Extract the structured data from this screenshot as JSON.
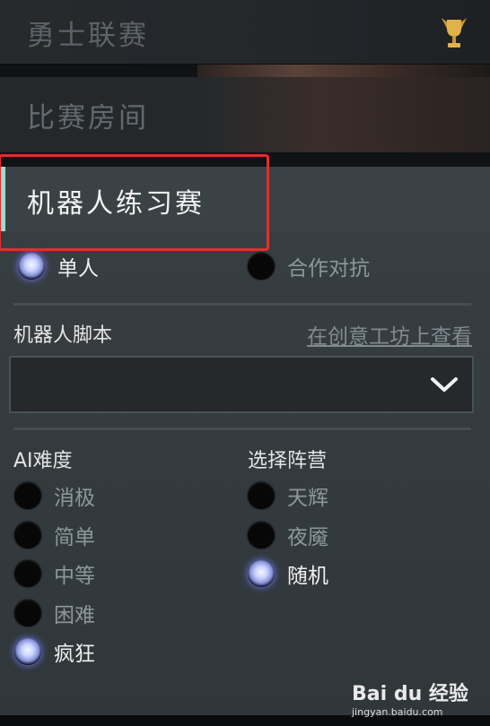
{
  "menu": {
    "top_label": "勇士联赛",
    "room_label": "比赛房间",
    "selected_label": "机器人练习赛"
  },
  "mode": {
    "options": [
      {
        "label": "单人",
        "selected": true
      },
      {
        "label": "合作对抗",
        "selected": false
      }
    ]
  },
  "script": {
    "title": "机器人脚本",
    "workshop_link": "在创意工坊上查看",
    "dropdown_value": ""
  },
  "ai_difficulty": {
    "title": "AI难度",
    "options": [
      {
        "label": "消极",
        "selected": false
      },
      {
        "label": "简单",
        "selected": false
      },
      {
        "label": "中等",
        "selected": false
      },
      {
        "label": "困难",
        "selected": false
      },
      {
        "label": "疯狂",
        "selected": true
      }
    ]
  },
  "faction": {
    "title": "选择阵营",
    "options": [
      {
        "label": "天辉",
        "selected": false
      },
      {
        "label": "夜魇",
        "selected": false
      },
      {
        "label": "随机",
        "selected": true
      }
    ]
  },
  "watermark": {
    "logo_text": "Bai du 经验",
    "url": "jingyan.baidu.com"
  },
  "colors": {
    "highlight_border": "#e0302a",
    "accent_bar": "#9fd9d3",
    "radio_glow": "#6f7cff"
  }
}
